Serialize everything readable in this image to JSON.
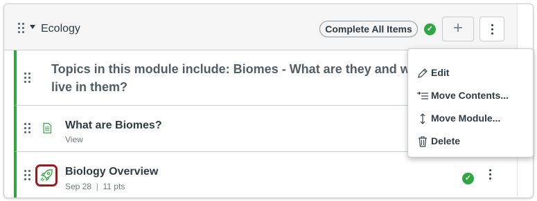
{
  "module": {
    "title": "Ecology",
    "complete_all_label": "Complete All Items",
    "add_symbol": "+"
  },
  "items": {
    "subheader_text": "Topics in this module include: Biomes - What are they and what live in them?",
    "page_title": "What are Biomes?",
    "page_sub": "View",
    "quiz_title": "Biology Overview",
    "quiz_due": "Sep 28",
    "quiz_points": "11 pts"
  },
  "menu": {
    "edit": "Edit",
    "move_contents": "Move Contents...",
    "move_module": "Move Module...",
    "delete": "Delete"
  },
  "colors": {
    "accent_green": "#2ea642",
    "quiz_border": "#a0171c"
  },
  "icons": [
    "drag-handle-icon",
    "caret-down-icon",
    "check-icon",
    "plus-icon",
    "kebab-icon",
    "page-icon",
    "rocket-icon",
    "pencil-icon",
    "move-contents-icon",
    "move-module-icon",
    "trash-icon"
  ]
}
